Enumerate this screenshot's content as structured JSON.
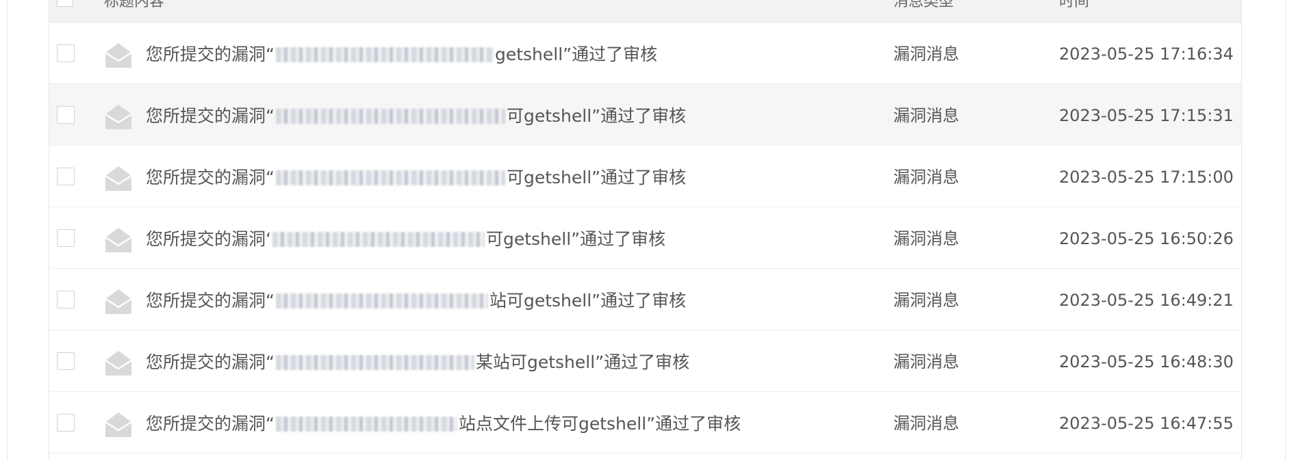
{
  "header": {
    "title_col": "标题内容",
    "type_col": "消息类型",
    "time_col": "时间"
  },
  "rows": [
    {
      "prefix": "您所提交的漏洞“",
      "suffix": "getshell”通过了审核",
      "type": "漏洞消息",
      "time": "2023-05-25 17:16:34"
    },
    {
      "prefix": "您所提交的漏洞“",
      "suffix": "可getshell”通过了审核",
      "type": "漏洞消息",
      "time": "2023-05-25 17:15:31"
    },
    {
      "prefix": "您所提交的漏洞“",
      "suffix": "可getshell”通过了审核",
      "type": "漏洞消息",
      "time": "2023-05-25 17:15:00"
    },
    {
      "prefix": "您所提交的漏洞‘",
      "suffix": "可getshell”通过了审核",
      "type": "漏洞消息",
      "time": "2023-05-25 16:50:26"
    },
    {
      "prefix": "您所提交的漏洞“",
      "suffix": "站可getshell”通过了审核",
      "type": "漏洞消息",
      "time": "2023-05-25 16:49:21"
    },
    {
      "prefix": "您所提交的漏洞“",
      "suffix": "某站可getshell”通过了审核",
      "type": "漏洞消息",
      "time": "2023-05-25 16:48:30"
    },
    {
      "prefix": "您所提交的漏洞“",
      "suffix": "站点文件上传可getshell”通过了审核",
      "type": "漏洞消息",
      "time": "2023-05-25 16:47:55"
    }
  ],
  "icons": {
    "row_icon": "envelope-open-icon",
    "icon_color": "#d9d9d9"
  }
}
